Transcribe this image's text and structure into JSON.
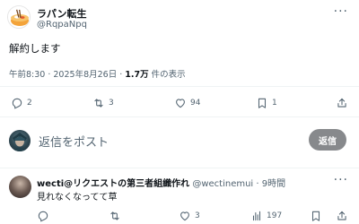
{
  "post": {
    "author_name": "ラパン転生",
    "author_handle": "@RqpaNpq",
    "text": "解約します",
    "timestamp": "午前8:30 · 2025年8月26日 · ",
    "views_count": "1.7万",
    "views_label": " 件の表示",
    "actions": {
      "replies": "2",
      "reposts": "3",
      "likes": "94",
      "bookmarks": "1"
    }
  },
  "reply_box": {
    "placeholder": "返信をポスト",
    "button_label": "返信"
  },
  "comment": {
    "author_name": "wecti@リクエストの第三者組織作れ",
    "author_handle": " @wectinemui · 9時間",
    "text": "見れなくなってて草",
    "actions": {
      "likes": "3",
      "views": "197"
    }
  },
  "colors": {
    "text_primary": "#0f1419",
    "text_secondary": "#536471",
    "divider": "#eff3f4",
    "reply_button_bg": "#87898c"
  }
}
